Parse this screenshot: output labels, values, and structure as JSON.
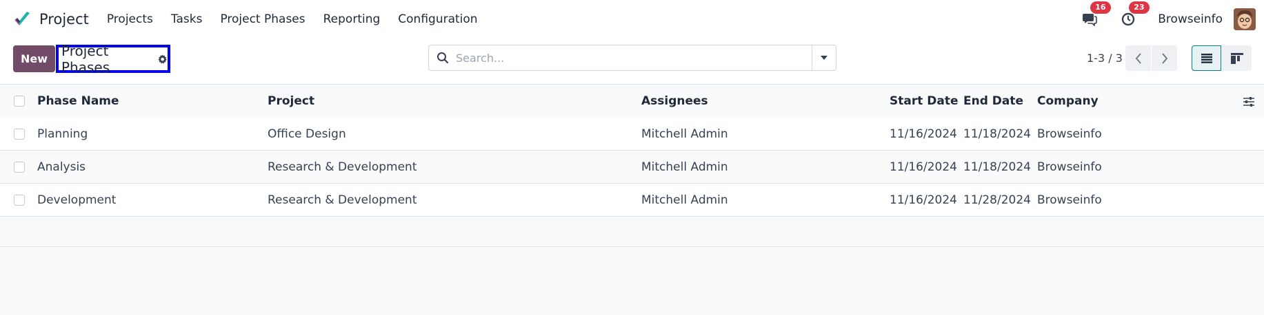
{
  "app": {
    "name": "Project",
    "menu": [
      "Projects",
      "Tasks",
      "Project Phases",
      "Reporting",
      "Configuration"
    ],
    "accent_color": "#714b67"
  },
  "systray": {
    "messages_count": "16",
    "activities_count": "23",
    "company": "Browseinfo"
  },
  "control": {
    "new_label": "New",
    "breadcrumb_title": "Project Phases",
    "search_placeholder": "Search...",
    "pager": "1-3 / 3"
  },
  "table": {
    "columns": {
      "phase": "Phase Name",
      "project": "Project",
      "assignees": "Assignees",
      "start": "Start Date",
      "end": "End Date",
      "company": "Company"
    },
    "rows": [
      {
        "phase": "Planning",
        "project": "Office Design",
        "assignees": "Mitchell Admin",
        "start": "11/16/2024",
        "end": "11/18/2024",
        "company": "Browseinfo"
      },
      {
        "phase": "Analysis",
        "project": "Research & Development",
        "assignees": "Mitchell Admin",
        "start": "11/16/2024",
        "end": "11/18/2024",
        "company": "Browseinfo"
      },
      {
        "phase": "Development",
        "project": "Research & Development",
        "assignees": "Mitchell Admin",
        "start": "11/16/2024",
        "end": "11/28/2024",
        "company": "Browseinfo"
      }
    ]
  }
}
